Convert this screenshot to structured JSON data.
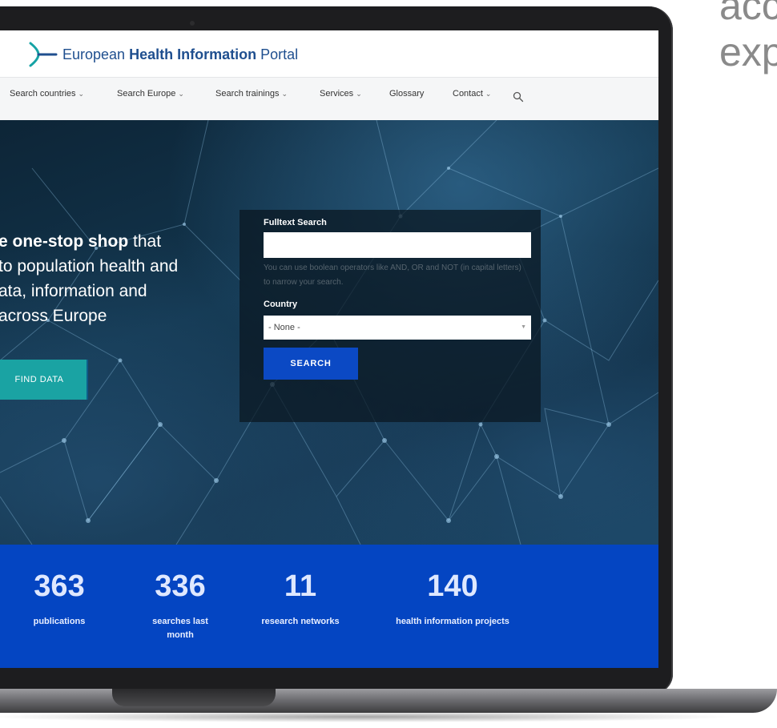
{
  "side_text": {
    "line1": "acc",
    "line2": "exp"
  },
  "site": {
    "logo_prefix": "European ",
    "logo_bold": "Health Information",
    "logo_suffix": " Portal"
  },
  "nav": {
    "items": [
      {
        "label": "Search countries",
        "has_dropdown": true
      },
      {
        "label": "Search Europe",
        "has_dropdown": true
      },
      {
        "label": "Search trainings",
        "has_dropdown": true
      },
      {
        "label": "Services",
        "has_dropdown": true
      },
      {
        "label": "Glossary",
        "has_dropdown": false
      },
      {
        "label": "Contact",
        "has_dropdown": true
      }
    ],
    "search_icon": "search-icon"
  },
  "hero": {
    "line1_bold": "e one-stop shop",
    "line1_rest": " that",
    "line2": "to population health and",
    "line3": "ata, information and",
    "line4": " across Europe",
    "button": "FIND DATA"
  },
  "search": {
    "fulltext_label": "Fulltext Search",
    "fulltext_value": "",
    "help": "You can use boolean operators like AND, OR and NOT (in capital letters) to narrow your search.",
    "country_label": "Country",
    "country_value": "- None -",
    "button": "SEARCH"
  },
  "stats": [
    {
      "value": "363",
      "label": "publications"
    },
    {
      "value": "336",
      "label": "searches last month"
    },
    {
      "value": "11",
      "label": "research networks"
    },
    {
      "value": "140",
      "label": "health information projects"
    }
  ],
  "colors": {
    "brand_blue": "#0445c2",
    "teal": "#1aa3a3",
    "search_button": "#0b49c4"
  }
}
